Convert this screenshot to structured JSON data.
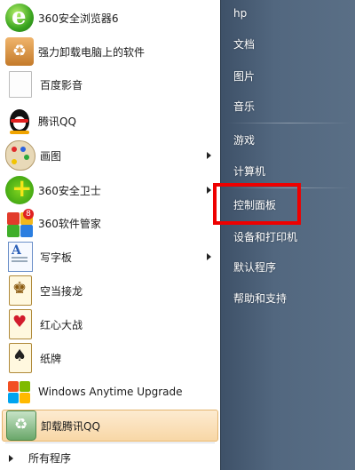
{
  "left_menu": {
    "items": [
      {
        "label": "360安全浏览器6",
        "icon": "browser-360-icon",
        "has_submenu": false
      },
      {
        "label": "强力卸载电脑上的软件",
        "icon": "uninstall-box-icon",
        "has_submenu": false
      },
      {
        "label": "百度影音",
        "icon": "blank-document-icon",
        "has_submenu": false
      },
      {
        "label": "腾讯QQ",
        "icon": "qq-penguin-icon",
        "has_submenu": false
      },
      {
        "label": "画图",
        "icon": "paint-palette-icon",
        "has_submenu": true
      },
      {
        "label": "360安全卫士",
        "icon": "security-360-icon",
        "has_submenu": true
      },
      {
        "label": "360软件管家",
        "icon": "software-manager-icon",
        "has_submenu": false
      },
      {
        "label": "写字板",
        "icon": "wordpad-icon",
        "has_submenu": true
      },
      {
        "label": "空当接龙",
        "icon": "freecell-icon",
        "has_submenu": false
      },
      {
        "label": "红心大战",
        "icon": "hearts-icon",
        "has_submenu": false
      },
      {
        "label": "纸牌",
        "icon": "solitaire-icon",
        "has_submenu": false
      },
      {
        "label": "Windows Anytime Upgrade",
        "icon": "windows-logo-icon",
        "has_submenu": false
      },
      {
        "label": "卸载腾讯QQ",
        "icon": "recycle-bin-icon",
        "has_submenu": false,
        "active": true
      }
    ],
    "all_programs": "所有程序"
  },
  "right_menu": {
    "items": [
      "hp",
      "文档",
      "图片",
      "音乐",
      "游戏",
      "计算机",
      "控制面板",
      "设备和打印机",
      "默认程序",
      "帮助和支持"
    ]
  },
  "highlight": {
    "target": "控制面板",
    "color": "#ee0000"
  },
  "colors": {
    "right_panel": "#52677f",
    "active_item_bg": "#f8d7a6",
    "highlight_border": "#ee0000"
  }
}
